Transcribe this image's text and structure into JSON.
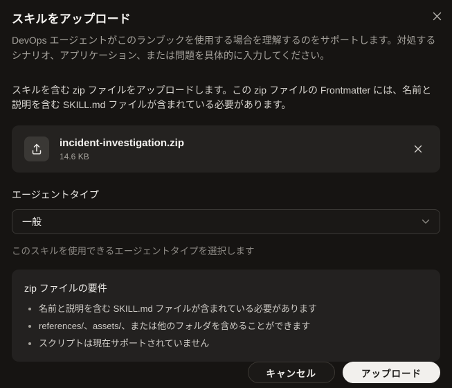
{
  "modal": {
    "title": "スキルをアップロード",
    "description": "DevOps エージェントがこのランブックを使用する場合を理解するのをサポートします。対処するシナリオ、アプリケーション、または問題を具体的に入力してください。"
  },
  "body": {
    "intro": "スキルを含む zip ファイルをアップロードします。この zip ファイルの Frontmatter には、名前と説明を含む SKILL.md ファイルが含まれている必要があります。",
    "file": {
      "name": "incident-investigation.zip",
      "size": "14.6 KB"
    },
    "agent_type": {
      "label": "エージェントタイプ",
      "selected_value": "一般",
      "helper": "このスキルを使用できるエージェントタイプを選択します"
    },
    "requirements": {
      "title": "zip ファイルの要件",
      "items": [
        "名前と説明を含む SKILL.md ファイルが含まれている必要があります",
        "references/、assets/、または他のフォルダを含めることができます",
        "スクリプトは現在サポートされていません"
      ]
    }
  },
  "footer": {
    "cancel_label": "キャンセル",
    "upload_label": "アップロード"
  },
  "icons": {
    "close": "x-icon",
    "upload": "upload-tray-arrow-icon",
    "remove_file": "x-icon",
    "dropdown": "chevron-down-icon"
  },
  "colors": {
    "background": "#161412",
    "card": "#242220",
    "icon_box": "#3a3835",
    "border": "#3b3936",
    "divider": "#2b2926",
    "text_primary": "#f5f3f0",
    "text_secondary": "#a5a29c",
    "text_muted": "#8c8984",
    "button_primary_bg": "#f2f0ed",
    "button_primary_text": "#1a1815"
  }
}
